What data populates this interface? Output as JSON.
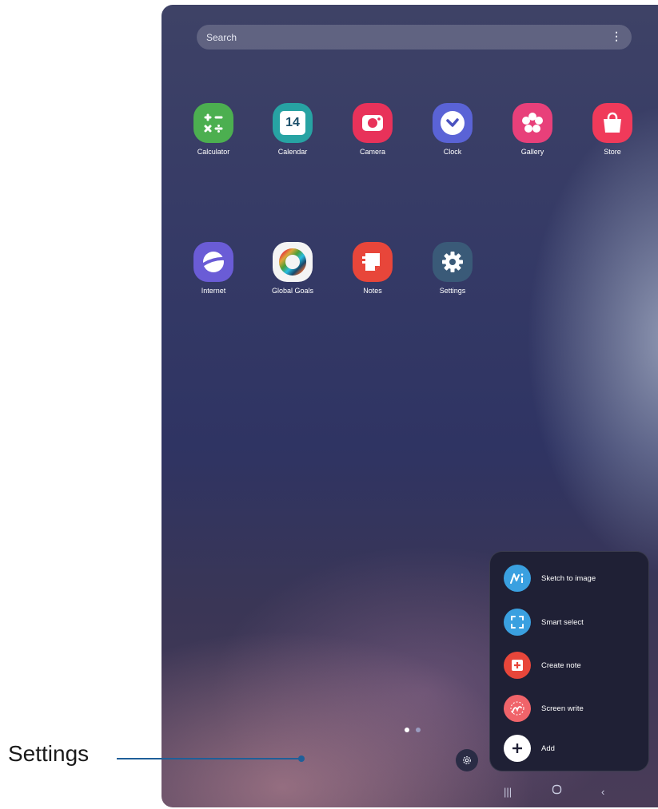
{
  "search": {
    "placeholder": "Search"
  },
  "apps": [
    {
      "label": "Calculator",
      "color": "#4caf50"
    },
    {
      "label": "Calendar",
      "color": "#27a3a3",
      "badge": "14"
    },
    {
      "label": "Camera",
      "color": "#e8325a"
    },
    {
      "label": "Clock",
      "color": "#5a63d6"
    },
    {
      "label": "Gallery",
      "color": "#e8407a"
    },
    {
      "label": "Store",
      "color": "#f03a5a"
    },
    {
      "label": "Internet",
      "color": "#6a5cd6"
    },
    {
      "label": "Global Goals",
      "color": "#f4f4f4"
    },
    {
      "label": "Notes",
      "color": "#e8463a"
    },
    {
      "label": "Settings",
      "color": "#3a5a78"
    }
  ],
  "panel_items": [
    {
      "label": "Sketch to image",
      "color": "#3aa0e0"
    },
    {
      "label": "Smart select",
      "color": "#3aa0e0"
    },
    {
      "label": "Create note",
      "color": "#e8463a"
    },
    {
      "label": "Screen write",
      "color": "#f0646a"
    },
    {
      "label": "Add",
      "color": "#ffffff"
    }
  ],
  "callout": {
    "label": "Settings"
  }
}
